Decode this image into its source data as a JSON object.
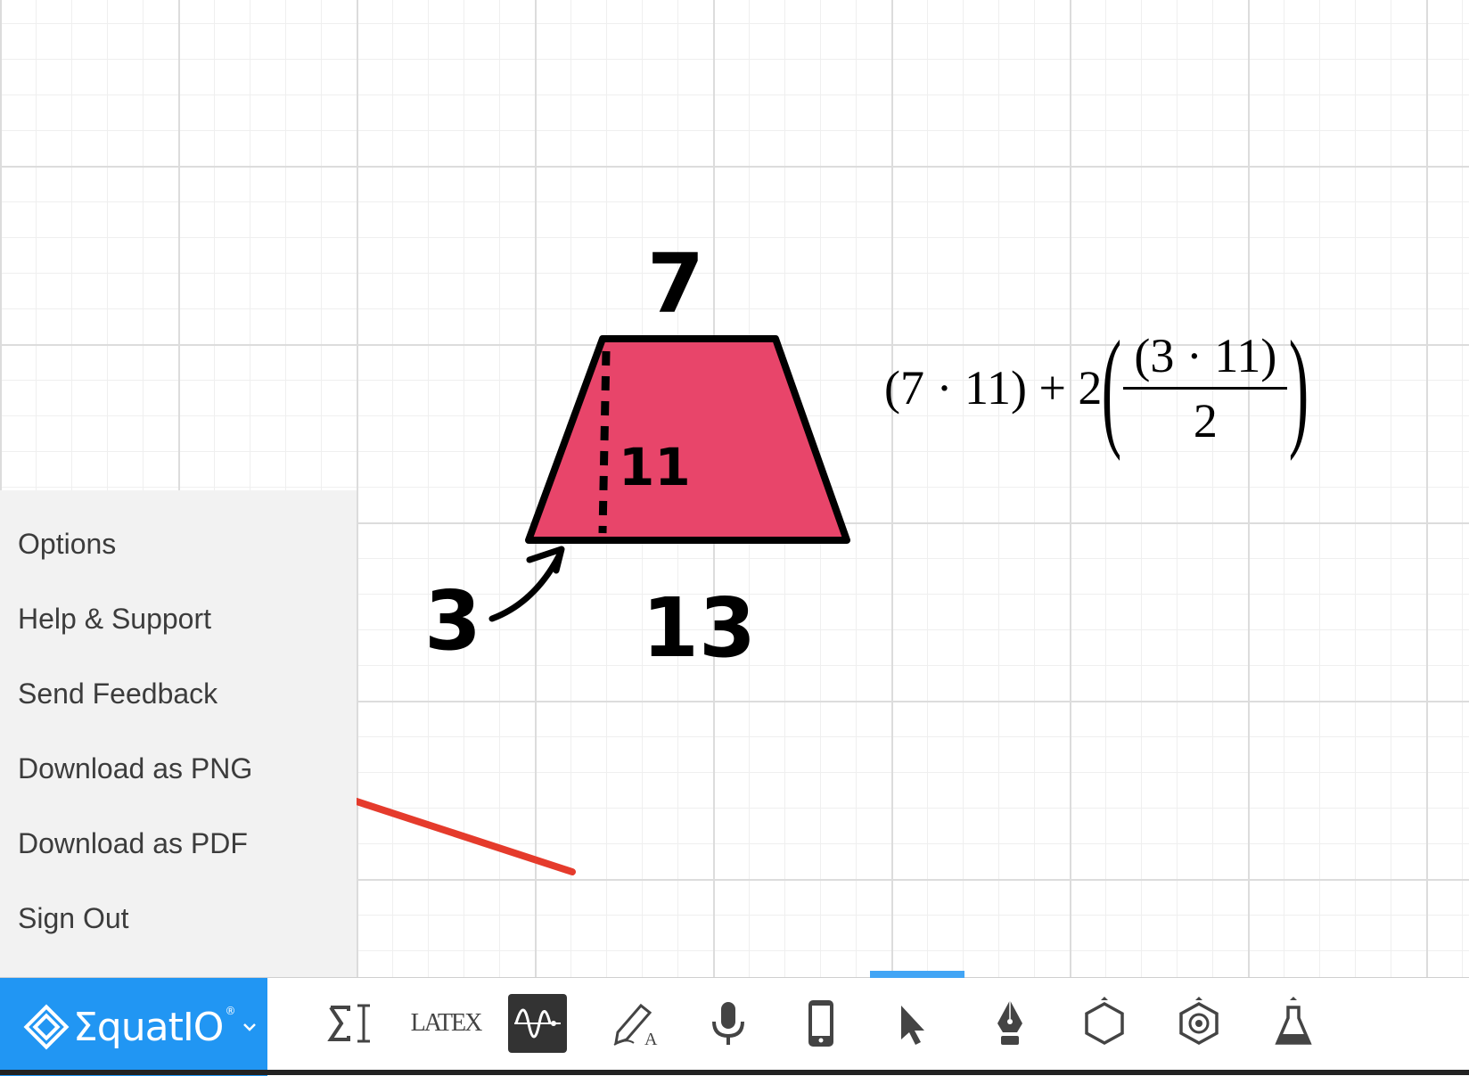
{
  "canvas": {
    "drawing": {
      "top_label": "7",
      "height_label": "11",
      "bottom_label": "13",
      "side_label": "3",
      "fill_color": "#e8456a"
    },
    "equation": {
      "part1": "(7 · 11) + 2",
      "numerator": "(3 · 11)",
      "denominator": "2"
    }
  },
  "menu": {
    "items": [
      {
        "label": "Options"
      },
      {
        "label": "Help & Support"
      },
      {
        "label": "Send Feedback"
      },
      {
        "label": "Download as PNG"
      },
      {
        "label": "Download as PDF"
      },
      {
        "label": "Sign Out"
      }
    ]
  },
  "toolbar": {
    "brand": "ΣquatIO",
    "brand_reg": "®",
    "brand_color": "#2196f3",
    "tools": [
      {
        "name": "math-editor",
        "icon": "sigma-cursor-icon"
      },
      {
        "name": "latex",
        "label": "LATEX",
        "icon": "latex-icon"
      },
      {
        "name": "graph",
        "icon": "wave-graph-icon"
      },
      {
        "name": "handwriting",
        "icon": "pencil-icon"
      },
      {
        "name": "speech",
        "icon": "microphone-icon"
      },
      {
        "name": "mobile",
        "icon": "phone-icon"
      },
      {
        "name": "select",
        "icon": "pointer-icon",
        "active": true
      },
      {
        "name": "pen",
        "icon": "pen-nib-icon"
      },
      {
        "name": "shapes",
        "icon": "hexagon-icon"
      },
      {
        "name": "chemistry",
        "icon": "molecule-icon"
      },
      {
        "name": "lab",
        "icon": "flask-icon"
      }
    ],
    "accent_color": "#42a5f5"
  },
  "annotation": {
    "arrow_color": "#e53b2c"
  }
}
